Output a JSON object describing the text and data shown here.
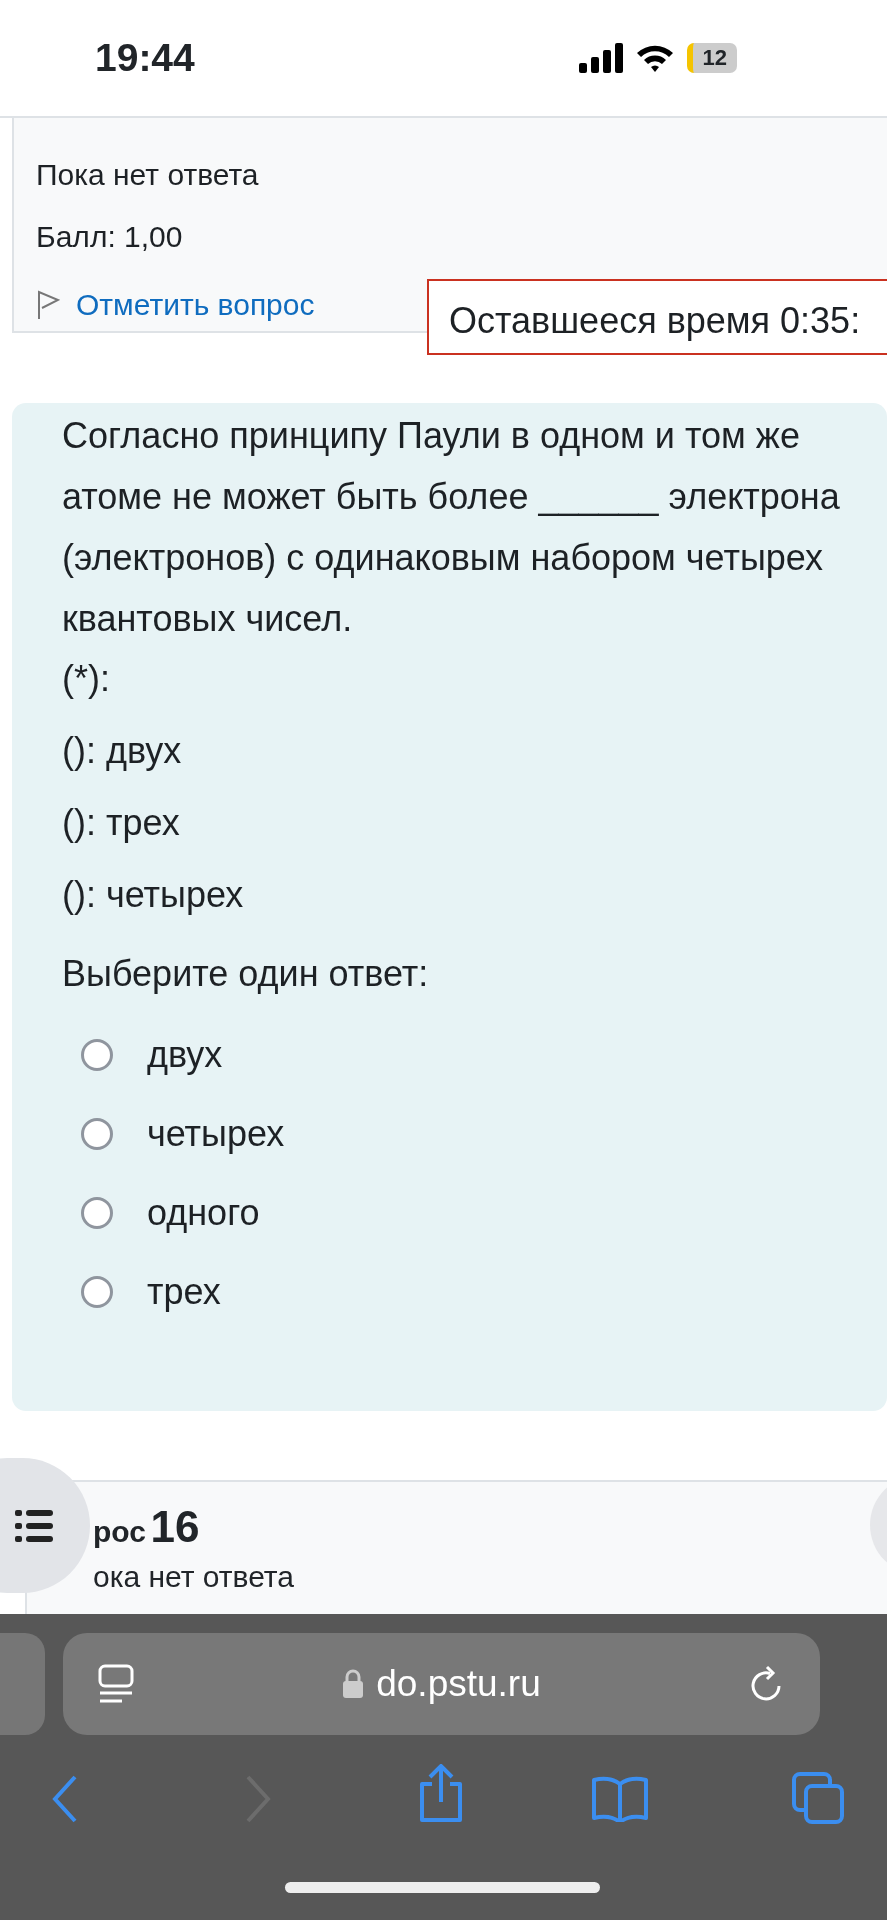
{
  "status_bar": {
    "time": "19:44",
    "battery": "12"
  },
  "previous_question": {
    "state": "Пока нет ответа",
    "grade": "Балл: 1,00",
    "flag_link": "Отметить вопрос"
  },
  "timer": {
    "text": "Оставшееся время 0:35:"
  },
  "question": {
    "text": "Согласно принципу Паули в одном и том же атоме не может быть более ______ электрона (электронов) с одинаковым набором четырех квантовых чисел.",
    "lines": [
      "(*):",
      "(): двух",
      "(): трех",
      "(): четырех"
    ],
    "prompt": "Выберите один ответ:",
    "options": [
      {
        "label": "двух",
        "selected": false
      },
      {
        "label": "четырех",
        "selected": false
      },
      {
        "label": "одного",
        "selected": false
      },
      {
        "label": "трех",
        "selected": false
      }
    ]
  },
  "next_question": {
    "title_part": "рос",
    "number": "16",
    "state": "ока нет ответа"
  },
  "browser": {
    "url": "do.pstu.ru"
  }
}
